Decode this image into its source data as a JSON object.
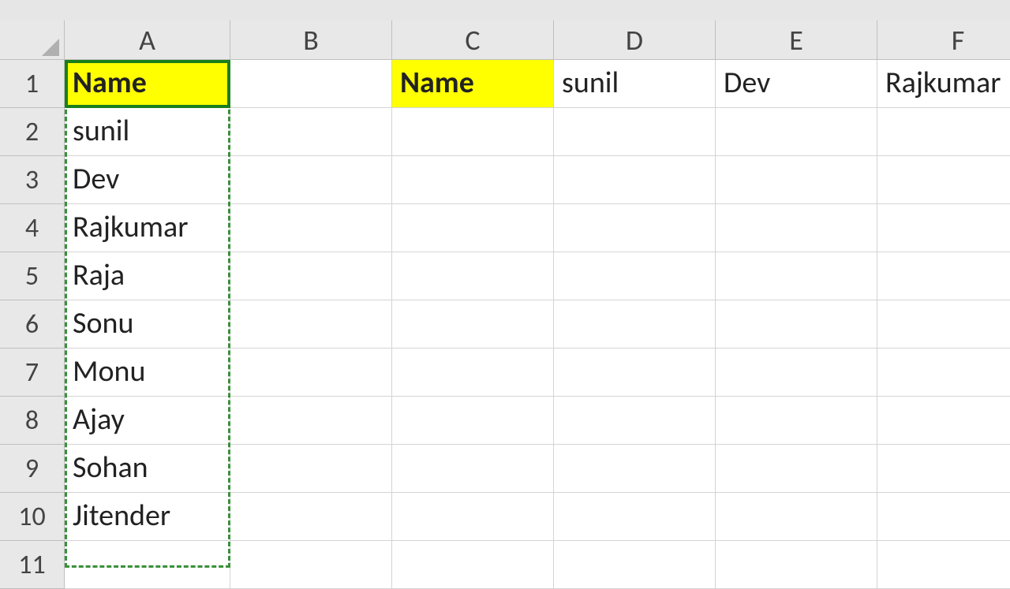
{
  "columns": [
    "A",
    "B",
    "C",
    "D",
    "E",
    "F"
  ],
  "rows": [
    "1",
    "2",
    "3",
    "4",
    "5",
    "6",
    "7",
    "8",
    "9",
    "10",
    "11"
  ],
  "cells": {
    "A1": "Name",
    "C1": "Name",
    "D1": "sunil",
    "E1": "Dev",
    "F1": "Rajkumar",
    "A2": "sunil",
    "A3": "Dev",
    "A4": "Rajkumar",
    "A5": "Raja",
    "A6": "Sonu",
    "A7": "Monu",
    "A8": "Ajay",
    "A9": "Sohan",
    "A10": "Jitender",
    "A11": ""
  },
  "highlighted": [
    "A1",
    "C1"
  ],
  "active_cell": "A1",
  "copied_range": "A1:A11"
}
